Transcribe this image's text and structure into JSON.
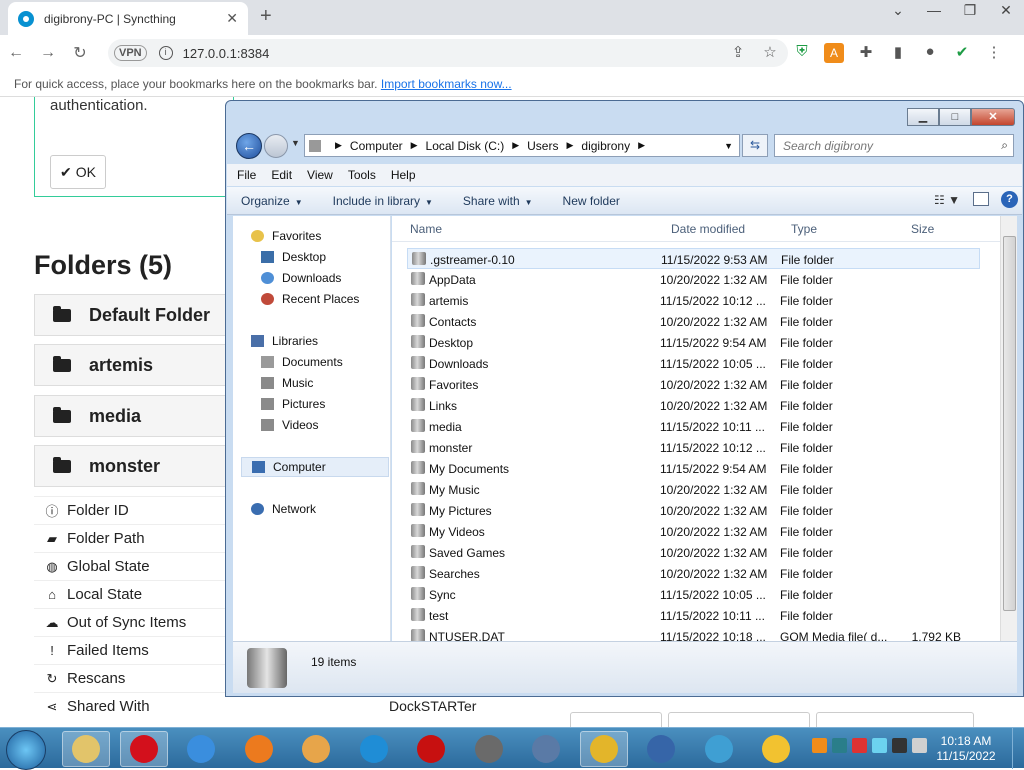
{
  "browser": {
    "tab_title": "digibrony-PC | Syncthing",
    "tab_close": "✕",
    "new_tab": "+",
    "window_controls": [
      "⌄",
      "—",
      "❐",
      "✕"
    ],
    "vpn_label": "VPN",
    "url": "127.0.0.1:8384",
    "bookmarks_text": "For quick access, place your bookmarks here on the bookmarks bar.",
    "bookmarks_link": "Import bookmarks now..."
  },
  "syncthing": {
    "auth_text": "authentication.",
    "ok_label": "OK",
    "folders_heading": "Folders (5)",
    "folders": [
      "Default Folder",
      "artemis",
      "media",
      "monster"
    ],
    "details": [
      {
        "icon": "info-icon",
        "glyph": "ⓘ",
        "label": "Folder ID"
      },
      {
        "icon": "folder-open-icon",
        "glyph": "▰",
        "label": "Folder Path"
      },
      {
        "icon": "globe-icon",
        "glyph": "◍",
        "label": "Global State"
      },
      {
        "icon": "home-icon",
        "glyph": "⌂",
        "label": "Local State"
      },
      {
        "icon": "cloud-download-icon",
        "glyph": "☁",
        "label": "Out of Sync Items"
      },
      {
        "icon": "exclamation-icon",
        "glyph": "!",
        "label": "Failed Items"
      },
      {
        "icon": "refresh-icon",
        "glyph": "↻",
        "label": "Rescans"
      },
      {
        "icon": "share-icon",
        "glyph": "⋖",
        "label": "Shared With"
      }
    ],
    "shared_with_value": "DockSTARTer"
  },
  "explorer": {
    "breadcrumb": [
      "Computer",
      "Local Disk (C:)",
      "Users",
      "digibrony"
    ],
    "search_placeholder": "Search digibrony",
    "menu": [
      "File",
      "Edit",
      "View",
      "Tools",
      "Help"
    ],
    "commands": [
      "Organize",
      "Include in library",
      "Share with",
      "New folder"
    ],
    "nav": {
      "favorites_label": "Favorites",
      "favorites": [
        "Desktop",
        "Downloads",
        "Recent Places"
      ],
      "libraries_label": "Libraries",
      "libraries": [
        "Documents",
        "Music",
        "Pictures",
        "Videos"
      ],
      "computer_label": "Computer",
      "network_label": "Network"
    },
    "columns": [
      "Name",
      "Date modified",
      "Type",
      "Size"
    ],
    "files": [
      {
        "name": ".gstreamer-0.10",
        "date": "11/15/2022 9:53 AM",
        "type": "File folder",
        "size": ""
      },
      {
        "name": "AppData",
        "date": "10/20/2022 1:32 AM",
        "type": "File folder",
        "size": ""
      },
      {
        "name": "artemis",
        "date": "11/15/2022 10:12 ...",
        "type": "File folder",
        "size": ""
      },
      {
        "name": "Contacts",
        "date": "10/20/2022 1:32 AM",
        "type": "File folder",
        "size": ""
      },
      {
        "name": "Desktop",
        "date": "11/15/2022 9:54 AM",
        "type": "File folder",
        "size": ""
      },
      {
        "name": "Downloads",
        "date": "11/15/2022 10:05 ...",
        "type": "File folder",
        "size": ""
      },
      {
        "name": "Favorites",
        "date": "10/20/2022 1:32 AM",
        "type": "File folder",
        "size": ""
      },
      {
        "name": "Links",
        "date": "10/20/2022 1:32 AM",
        "type": "File folder",
        "size": ""
      },
      {
        "name": "media",
        "date": "11/15/2022 10:11 ...",
        "type": "File folder",
        "size": ""
      },
      {
        "name": "monster",
        "date": "11/15/2022 10:12 ...",
        "type": "File folder",
        "size": ""
      },
      {
        "name": "My Documents",
        "date": "11/15/2022 9:54 AM",
        "type": "File folder",
        "size": ""
      },
      {
        "name": "My Music",
        "date": "10/20/2022 1:32 AM",
        "type": "File folder",
        "size": ""
      },
      {
        "name": "My Pictures",
        "date": "10/20/2022 1:32 AM",
        "type": "File folder",
        "size": ""
      },
      {
        "name": "My Videos",
        "date": "10/20/2022 1:32 AM",
        "type": "File folder",
        "size": ""
      },
      {
        "name": "Saved Games",
        "date": "10/20/2022 1:32 AM",
        "type": "File folder",
        "size": ""
      },
      {
        "name": "Searches",
        "date": "10/20/2022 1:32 AM",
        "type": "File folder",
        "size": ""
      },
      {
        "name": "Sync",
        "date": "11/15/2022 10:05 ...",
        "type": "File folder",
        "size": ""
      },
      {
        "name": "test",
        "date": "11/15/2022 10:11 ...",
        "type": "File folder",
        "size": ""
      },
      {
        "name": "NTUSER.DAT",
        "date": "11/15/2022 10:18 ...",
        "type": "GOM Media file( d...",
        "size": "1,792 KB"
      }
    ],
    "item_count": "19 items"
  },
  "taskbar": {
    "time": "10:18 AM",
    "date": "11/15/2022",
    "apps": [
      {
        "icon": "file-explorer-icon",
        "color": "#e2c46a"
      },
      {
        "icon": "opera-icon",
        "color": "#d3101c"
      },
      {
        "icon": "internet-explorer-icon",
        "color": "#3a8ede"
      },
      {
        "icon": "firefox-icon",
        "color": "#ec7a1e"
      },
      {
        "icon": "media-player-icon",
        "color": "#e7a54a"
      },
      {
        "icon": "edge-icon",
        "color": "#1f8dd6"
      },
      {
        "icon": "recorder-icon",
        "color": "#c71010"
      },
      {
        "icon": "media-player-classic-icon",
        "color": "#6a6a6a"
      },
      {
        "icon": "virtualbox-icon",
        "color": "#5a7aa6"
      },
      {
        "icon": "chrome-icon",
        "color": "#e3b52a"
      },
      {
        "icon": "remote-desktop-icon",
        "color": "#3665a8"
      },
      {
        "icon": "network-share-icon",
        "color": "#3f9fd3"
      },
      {
        "icon": "vpn-lock-icon",
        "color": "#f2c230"
      }
    ]
  }
}
